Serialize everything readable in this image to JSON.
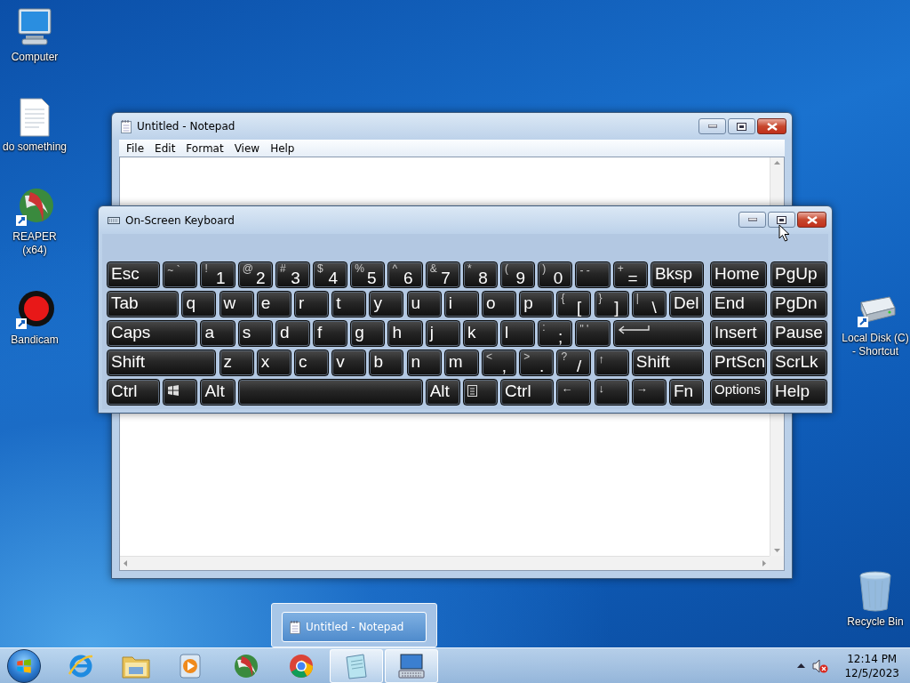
{
  "desktop": {
    "left_column": [
      {
        "kind": "computer",
        "label": "Computer"
      },
      {
        "kind": "document",
        "label": "do something"
      },
      {
        "kind": "reaper",
        "label": "REAPER (x64)"
      },
      {
        "kind": "bandicam",
        "label": "Bandicam"
      }
    ],
    "right_column": [
      {
        "kind": "drive",
        "label": "Local Disk (C) - Shortcut"
      },
      {
        "kind": "recycle",
        "label": "Recycle Bin"
      }
    ]
  },
  "notepad": {
    "title": "Untitled - Notepad",
    "menu": [
      "File",
      "Edit",
      "Format",
      "View",
      "Help"
    ]
  },
  "keyboard": {
    "title": "On-Screen Keyboard",
    "rows": [
      {
        "keys": [
          {
            "kind": "text",
            "label": "Esc"
          },
          {
            "kind": "pair",
            "shift": "~",
            "label": "`"
          },
          {
            "kind": "dual",
            "shift": "!",
            "label": "1"
          },
          {
            "kind": "dual",
            "shift": "@",
            "label": "2"
          },
          {
            "kind": "dual",
            "shift": "#",
            "label": "3"
          },
          {
            "kind": "dual",
            "shift": "$",
            "label": "4"
          },
          {
            "kind": "dual",
            "shift": "%",
            "label": "5"
          },
          {
            "kind": "dual",
            "shift": "^",
            "label": "6"
          },
          {
            "kind": "dual",
            "shift": "&",
            "label": "7"
          },
          {
            "kind": "dual",
            "shift": "*",
            "label": "8"
          },
          {
            "kind": "dual",
            "shift": "(",
            "label": "9"
          },
          {
            "kind": "dual",
            "shift": ")",
            "label": "0"
          },
          {
            "kind": "pair",
            "shift": "-",
            "label": "-"
          },
          {
            "kind": "dual",
            "shift": "+",
            "label": "="
          },
          {
            "kind": "text",
            "label": "Bksp"
          }
        ]
      },
      {
        "keys": [
          {
            "kind": "text",
            "label": "Tab"
          },
          {
            "kind": "text",
            "label": "q"
          },
          {
            "kind": "text",
            "label": "w"
          },
          {
            "kind": "text",
            "label": "e"
          },
          {
            "kind": "text",
            "label": "r"
          },
          {
            "kind": "text",
            "label": "t"
          },
          {
            "kind": "text",
            "label": "y"
          },
          {
            "kind": "text",
            "label": "u"
          },
          {
            "kind": "text",
            "label": "i"
          },
          {
            "kind": "text",
            "label": "o"
          },
          {
            "kind": "text",
            "label": "p"
          },
          {
            "kind": "dual",
            "shift": "{",
            "label": "["
          },
          {
            "kind": "dual",
            "shift": "}",
            "label": "]"
          },
          {
            "kind": "dual",
            "shift": "|",
            "label": "\\"
          },
          {
            "kind": "text",
            "label": "Del"
          }
        ]
      },
      {
        "keys": [
          {
            "kind": "text",
            "label": "Caps"
          },
          {
            "kind": "text",
            "label": "a"
          },
          {
            "kind": "text",
            "label": "s"
          },
          {
            "kind": "text",
            "label": "d"
          },
          {
            "kind": "text",
            "label": "f"
          },
          {
            "kind": "text",
            "label": "g"
          },
          {
            "kind": "text",
            "label": "h"
          },
          {
            "kind": "text",
            "label": "j"
          },
          {
            "kind": "text",
            "label": "k"
          },
          {
            "kind": "text",
            "label": "l"
          },
          {
            "kind": "dual",
            "shift": ":",
            "label": ";"
          },
          {
            "kind": "pair",
            "shift": "\"",
            "label": "'"
          },
          {
            "kind": "enter"
          }
        ]
      },
      {
        "keys": [
          {
            "kind": "text",
            "label": "Shift"
          },
          {
            "kind": "text",
            "label": "z"
          },
          {
            "kind": "text",
            "label": "x"
          },
          {
            "kind": "text",
            "label": "c"
          },
          {
            "kind": "text",
            "label": "v"
          },
          {
            "kind": "text",
            "label": "b"
          },
          {
            "kind": "text",
            "label": "n"
          },
          {
            "kind": "text",
            "label": "m"
          },
          {
            "kind": "dual",
            "shift": "<",
            "label": ","
          },
          {
            "kind": "dual",
            "shift": ">",
            "label": "."
          },
          {
            "kind": "dual",
            "shift": "?",
            "label": "/"
          },
          {
            "kind": "arrow",
            "label": "↑"
          },
          {
            "kind": "text",
            "label": "Shift"
          }
        ]
      },
      {
        "keys": [
          {
            "kind": "text",
            "label": "Ctrl"
          },
          {
            "kind": "windows"
          },
          {
            "kind": "text",
            "label": "Alt"
          },
          {
            "kind": "space"
          },
          {
            "kind": "text",
            "label": "Alt"
          },
          {
            "kind": "menu"
          },
          {
            "kind": "text",
            "label": "Ctrl"
          },
          {
            "kind": "arrow",
            "label": "←"
          },
          {
            "kind": "arrow",
            "label": "↓"
          },
          {
            "kind": "arrow",
            "label": "→"
          },
          {
            "kind": "text",
            "label": "Fn"
          }
        ]
      }
    ],
    "nav_keys": [
      {
        "kind": "text",
        "label": "Home"
      },
      {
        "kind": "text",
        "label": "PgUp"
      },
      {
        "kind": "text",
        "label": "End"
      },
      {
        "kind": "text",
        "label": "PgDn"
      },
      {
        "kind": "text",
        "label": "Insert"
      },
      {
        "kind": "text",
        "label": "Pause"
      },
      {
        "kind": "text",
        "label": "PrtScn"
      },
      {
        "kind": "text",
        "label": "ScrLk"
      },
      {
        "kind": "small",
        "label": "Options"
      },
      {
        "kind": "text",
        "label": "Help"
      }
    ]
  },
  "taskbar": {
    "thumbnail": {
      "label": "Untitled - Notepad"
    },
    "apps": [
      {
        "kind": "ie",
        "active": false
      },
      {
        "kind": "folder",
        "active": false
      },
      {
        "kind": "media",
        "active": false
      },
      {
        "kind": "reaper",
        "active": false
      },
      {
        "kind": "chrome",
        "active": false
      },
      {
        "kind": "notepad",
        "active": true
      },
      {
        "kind": "osk",
        "active": true
      }
    ],
    "clock": {
      "time": "12:14 PM",
      "date": "12/5/2023"
    }
  }
}
